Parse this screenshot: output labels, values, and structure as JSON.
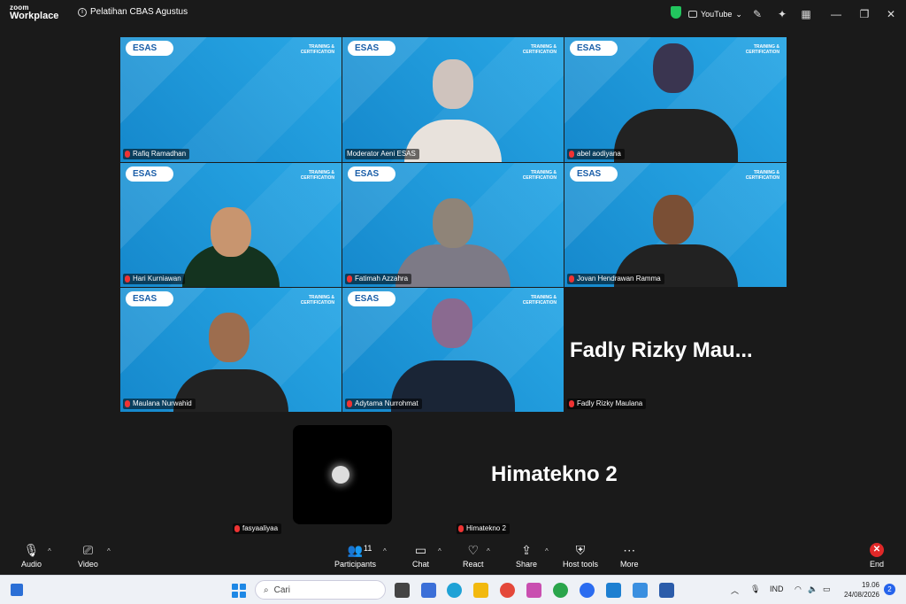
{
  "app": {
    "logo_top": "zoom",
    "logo_bottom": "Workplace",
    "meeting_title": "Pelatihan CBAS Agustus"
  },
  "titlebar": {
    "youtube_label": "YouTube"
  },
  "tiles": {
    "brand": "ESAS",
    "tagline_1": "TRAINING &",
    "tagline_2": "CERTIFICATION",
    "participants": [
      "Rafiq Ramadhan",
      "Moderator Aeni ESAS",
      "abel aodiyana",
      "Hari Kurniawan",
      "Fatimah Azzahra",
      "Jovan Hendrawan Ramma",
      "Maulana Nurwahid",
      "Adytama Nurrohmat",
      "Fadly Rizky Maulana",
      "fasyaaliyaa",
      "Himatekno 2"
    ],
    "fadly_big": "Fadly Rizky Mau...",
    "himatekno_big": "Himatekno 2"
  },
  "toolbar": {
    "audio": "Audio",
    "video": "Video",
    "participants": "Participants",
    "participants_count": "11",
    "chat": "Chat",
    "react": "React",
    "share": "Share",
    "host_tools": "Host tools",
    "more": "More",
    "end": "End"
  },
  "taskbar": {
    "search_placeholder": "Cari",
    "lang": "IND",
    "time": "19.06",
    "date": "24/08/2026",
    "notif_count": "2"
  }
}
